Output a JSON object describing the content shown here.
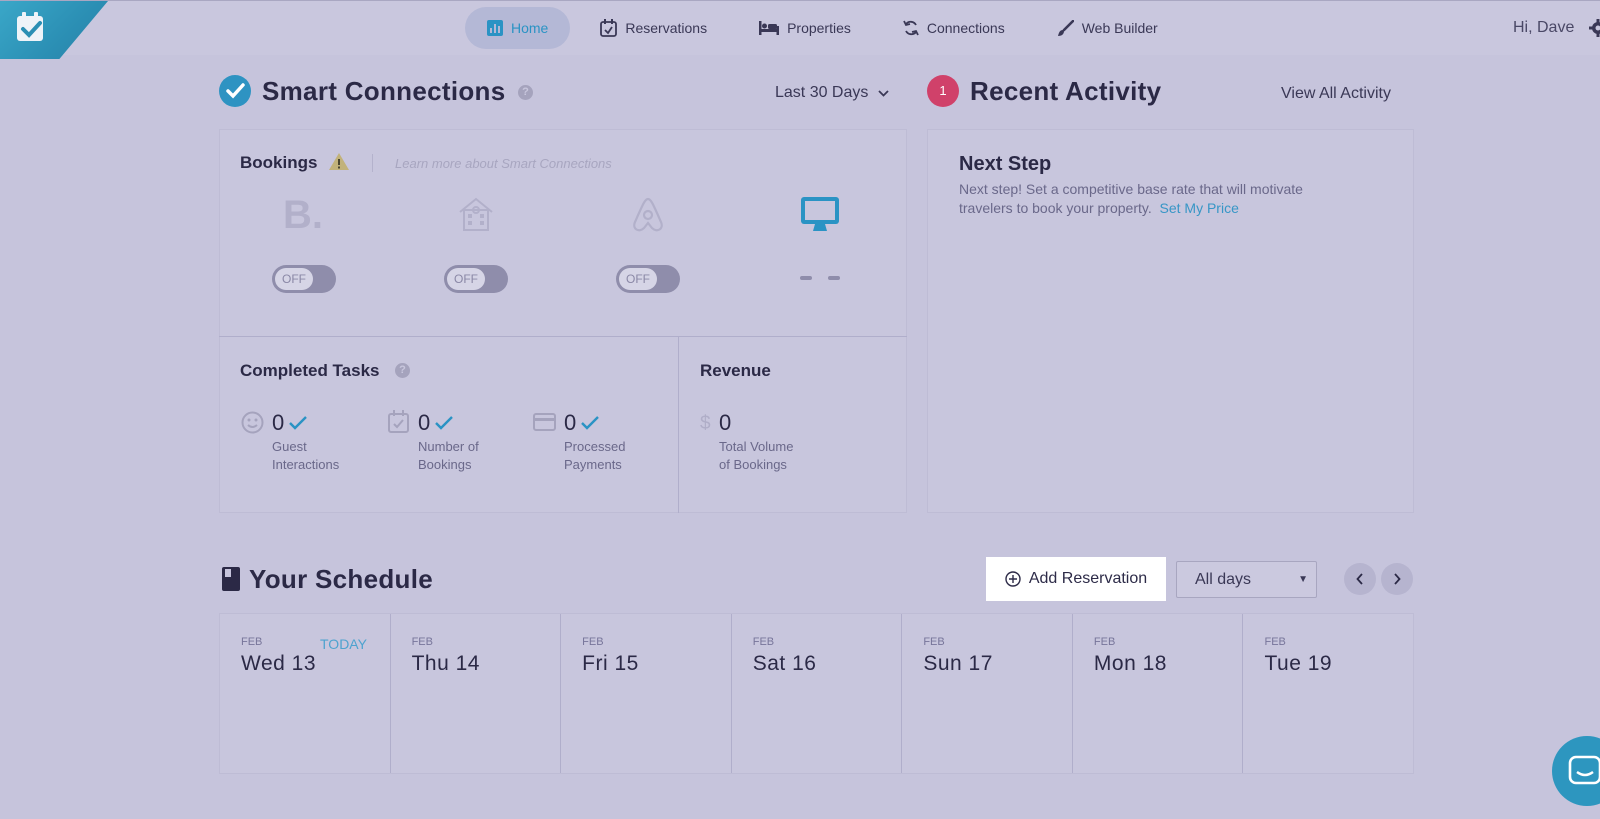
{
  "nav": {
    "items": [
      {
        "label": "Home",
        "icon": "bar-chart-icon",
        "active": true
      },
      {
        "label": "Reservations",
        "icon": "calendar-check-icon"
      },
      {
        "label": "Properties",
        "icon": "bed-icon"
      },
      {
        "label": "Connections",
        "icon": "sync-icon"
      },
      {
        "label": "Web Builder",
        "icon": "brush-icon"
      }
    ],
    "greeting": "Hi, Dave"
  },
  "smart": {
    "title": "Smart Connections",
    "help": "?",
    "range": "Last 30 Days",
    "bookings_label": "Bookings",
    "learn_more": "Learn more about Smart Connections",
    "channels": [
      {
        "icon": "booking-com-icon",
        "toggle": "OFF"
      },
      {
        "icon": "homeaway-icon",
        "toggle": "OFF"
      },
      {
        "icon": "airbnb-icon",
        "toggle": "OFF"
      },
      {
        "icon": "website-monitor-icon",
        "toggle": "– –"
      }
    ]
  },
  "tasks": {
    "title": "Completed Tasks",
    "help": "?",
    "items": [
      {
        "value": "0",
        "label_line1": "Guest",
        "label_line2": "Interactions"
      },
      {
        "value": "0",
        "label_line1": "Number of",
        "label_line2": "Bookings"
      },
      {
        "value": "0",
        "label_line1": "Processed",
        "label_line2": "Payments"
      }
    ]
  },
  "revenue": {
    "title": "Revenue",
    "currency": "$",
    "value": "0",
    "label_line1": "Total Volume",
    "label_line2": "of Bookings"
  },
  "activity": {
    "title": "Recent Activity",
    "badge": "1",
    "view_all": "View All Activity",
    "next_title": "Next Step",
    "next_text": "Next step! Set a competitive base rate that will motivate travelers to book your property.",
    "next_link": "Set My Price"
  },
  "schedule": {
    "title": "Your Schedule",
    "add_reservation": "Add Reservation",
    "filter": "All days",
    "today_label": "TODAY",
    "days": [
      {
        "month": "FEB",
        "date": "Wed 13"
      },
      {
        "month": "FEB",
        "date": "Thu 14"
      },
      {
        "month": "FEB",
        "date": "Fri 15"
      },
      {
        "month": "FEB",
        "date": "Sat 16"
      },
      {
        "month": "FEB",
        "date": "Sun 17"
      },
      {
        "month": "FEB",
        "date": "Mon 18"
      },
      {
        "month": "FEB",
        "date": "Tue 19"
      }
    ]
  },
  "colors": {
    "accent": "#2a93c4",
    "badge": "#d0416a",
    "background": "#c6c4dc"
  }
}
